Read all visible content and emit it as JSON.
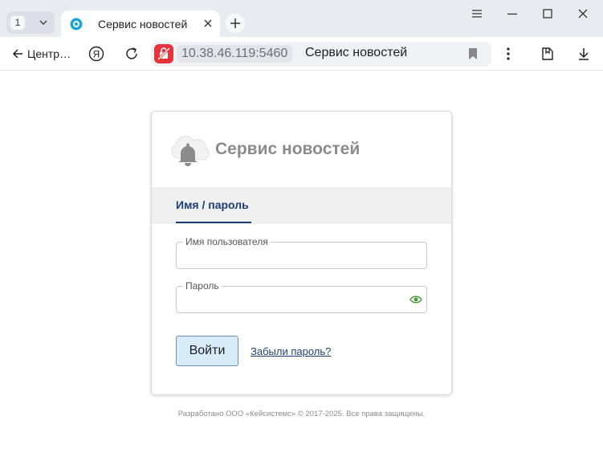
{
  "browser": {
    "tab_count": "1",
    "tab_title": "Сервис новостей",
    "back_label": "Центр…",
    "address_host": "10.38.46.119:5460",
    "address_title": "Сервис новостей"
  },
  "page": {
    "brand_title": "Сервис новостей",
    "auth_tab_label": "Имя / пароль",
    "username_label": "Имя пользователя",
    "username_value": "",
    "password_label": "Пароль",
    "password_value": "",
    "login_button": "Войти",
    "forgot_link": "Забыли пароль?",
    "footer": "Разработано ООО «Кейсистемс» © 2017-2025. Все права защищены."
  },
  "colors": {
    "accent_navy": "#1d3f72",
    "button_fill": "#d7ebf8",
    "shield_red": "#e8323c",
    "eye_green": "#4a9a3a"
  }
}
